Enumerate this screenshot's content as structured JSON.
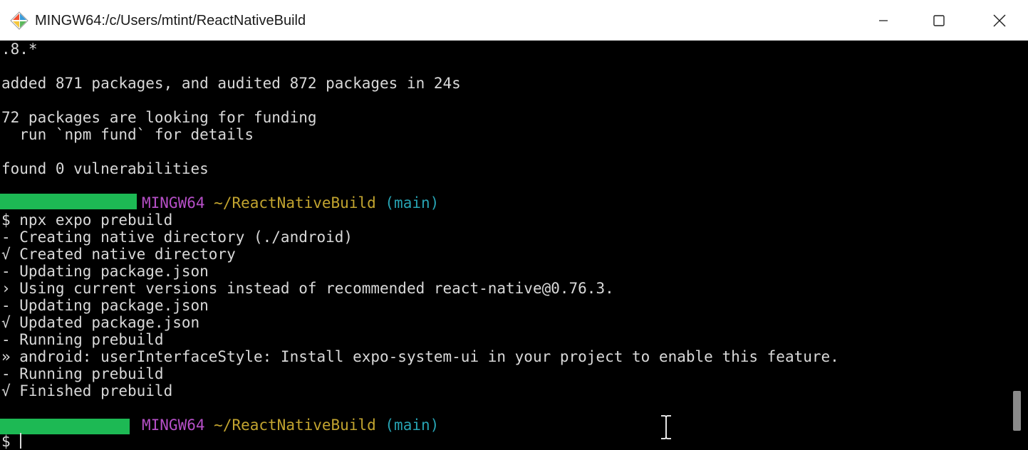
{
  "window": {
    "title": "MINGW64:/c/Users/mtint/ReactNativeBuild",
    "icon": "git-bash-icon",
    "controls": {
      "minimize": "minimize-icon",
      "maximize": "maximize-icon",
      "close": "close-icon"
    }
  },
  "terminal": {
    "lines": [
      {
        "text": ".8.*"
      },
      {
        "text": ""
      },
      {
        "text": "added 871 packages, and audited 872 packages in 24s"
      },
      {
        "text": ""
      },
      {
        "text": "72 packages are looking for funding"
      },
      {
        "text": "  run `npm fund` for details"
      },
      {
        "text": ""
      },
      {
        "text": "found 0 vulnerabilities"
      },
      {
        "text": ""
      }
    ],
    "prompt1": {
      "host": "MINGW64",
      "path": "~/ReactNativeBuild",
      "branch": "(main)"
    },
    "command_lines": [
      "$ npx expo prebuild",
      "- Creating native directory (./android)",
      "√ Created native directory",
      "- Updating package.json",
      "› Using current versions instead of recommended react-native@0.76.3.",
      "- Updating package.json",
      "√ Updated package.json",
      "- Running prebuild",
      "» android: userInterfaceStyle: Install expo-system-ui in your project to enable this feature.",
      "- Running prebuild",
      "√ Finished prebuild"
    ],
    "prompt2": {
      "host": "MINGW64",
      "path": "~/ReactNativeBuild",
      "branch": "(main)"
    },
    "input_prompt": "$ "
  },
  "colors": {
    "prompt_host": "#b64fc7",
    "prompt_path": "#c2a42f",
    "prompt_branch": "#27a3b3",
    "redaction": "#1db954"
  }
}
